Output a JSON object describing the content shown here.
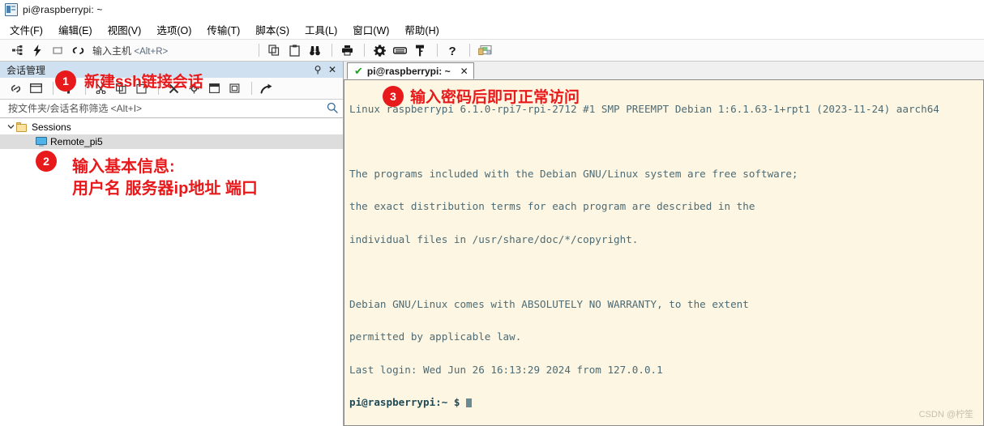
{
  "window": {
    "title": "pi@raspberrypi: ~",
    "icon": "terminal-window-icon"
  },
  "menubar": {
    "items": [
      {
        "label": "文件(F)",
        "name": "menu-file"
      },
      {
        "label": "编辑(E)",
        "name": "menu-edit"
      },
      {
        "label": "视图(V)",
        "name": "menu-view"
      },
      {
        "label": "选项(O)",
        "name": "menu-options"
      },
      {
        "label": "传输(T)",
        "name": "menu-transfer"
      },
      {
        "label": "脚本(S)",
        "name": "menu-script"
      },
      {
        "label": "工具(L)",
        "name": "menu-tools"
      },
      {
        "label": "窗口(W)",
        "name": "menu-window"
      },
      {
        "label": "帮助(H)",
        "name": "menu-help"
      }
    ]
  },
  "toolbar": {
    "host_label": "输入主机",
    "host_hotkey": "<Alt+R>",
    "buttons": [
      {
        "name": "new-session-icon",
        "glyph": "⊷"
      },
      {
        "name": "quick-connect-icon",
        "glyph": "⚡"
      },
      {
        "name": "reconnect-icon",
        "glyph": "⟳"
      },
      {
        "name": "disconnect-icon",
        "glyph": "⌁"
      },
      {
        "name": "copy-icon",
        "glyph": "⧉"
      },
      {
        "name": "paste-icon",
        "glyph": "📋"
      },
      {
        "name": "find-icon",
        "glyph": "🔍"
      },
      {
        "name": "print-icon",
        "glyph": "⎙"
      },
      {
        "name": "settings-gear-icon",
        "glyph": "⚙"
      },
      {
        "name": "keyboard-icon",
        "glyph": "⌨"
      },
      {
        "name": "key-icon",
        "glyph": "⚲"
      },
      {
        "name": "help-question-icon",
        "glyph": "?"
      },
      {
        "name": "file-transfer-icon",
        "glyph": "🗔"
      }
    ]
  },
  "session_panel": {
    "title": "会话管理",
    "pin_icon": "pin-icon",
    "close_icon": "close-icon",
    "filter_placeholder": "按文件夹/会话名称筛选 <Alt+I>",
    "filter_value": "",
    "filter_search_icon": "search-icon",
    "toolbar_buttons": [
      {
        "name": "link-icon",
        "glyph": "🔗"
      },
      {
        "name": "new-folder-icon",
        "glyph": "▭"
      },
      {
        "name": "new-session-icon",
        "glyph": "✚"
      },
      {
        "name": "cut-icon",
        "glyph": "✂"
      },
      {
        "name": "copy-icon",
        "glyph": "⧉"
      },
      {
        "name": "paste-icon",
        "glyph": "▢"
      },
      {
        "name": "delete-icon",
        "glyph": "✕"
      },
      {
        "name": "properties-icon",
        "glyph": "⚙"
      },
      {
        "name": "rename-icon",
        "glyph": "▤"
      },
      {
        "name": "duplicate-icon",
        "glyph": "⎘"
      },
      {
        "name": "share-icon",
        "glyph": "➦"
      }
    ],
    "tree": [
      {
        "label": "Sessions",
        "name": "tree-node-sessions",
        "icon": "folder-icon",
        "expanded": true,
        "chevron": "⌄",
        "selected": false,
        "level": 0
      },
      {
        "label": "Remote_pi5",
        "name": "tree-node-remote-pi5",
        "icon": "monitor-icon",
        "expanded": false,
        "chevron": "",
        "selected": true,
        "level": 1
      }
    ]
  },
  "terminal": {
    "tab": {
      "label": "pi@raspberrypi: ~",
      "status_icon": "green-check-icon",
      "status_glyph": "✔",
      "close_glyph": "✕"
    },
    "lines": [
      "Linux raspberrypi 6.1.0-rpi7-rpi-2712 #1 SMP PREEMPT Debian 1:6.1.63-1+rpt1 (2023-11-24) aarch64",
      "",
      "The programs included with the Debian GNU/Linux system are free software;",
      "the exact distribution terms for each program are described in the",
      "individual files in /usr/share/doc/*/copyright.",
      "",
      "Debian GNU/Linux comes with ABSOLUTELY NO WARRANTY, to the extent",
      "permitted by applicable law.",
      "Last login: Wed Jun 26 16:13:29 2024 from 127.0.0.1"
    ],
    "prompt": "pi@raspberrypi:~ $ ",
    "watermark": "CSDN @柠笙"
  },
  "annotations": [
    {
      "badge": "1",
      "text": "新建ssh链接会话",
      "name": "annotation-new-ssh-session"
    },
    {
      "badge": "2",
      "text": "输入基本信息:\n用户名 服务器ip地址 端口",
      "name": "annotation-enter-basic-info"
    },
    {
      "badge": "3",
      "text": "输入密码后即可正常访问",
      "name": "annotation-enter-password"
    }
  ],
  "colors": {
    "annotation_red": "#e8191b",
    "panel_header_blue": "#cfe0f0",
    "terminal_bg": "#fdf6e3",
    "terminal_fg": "#4d6b74",
    "selection_gray": "#dddddd"
  }
}
